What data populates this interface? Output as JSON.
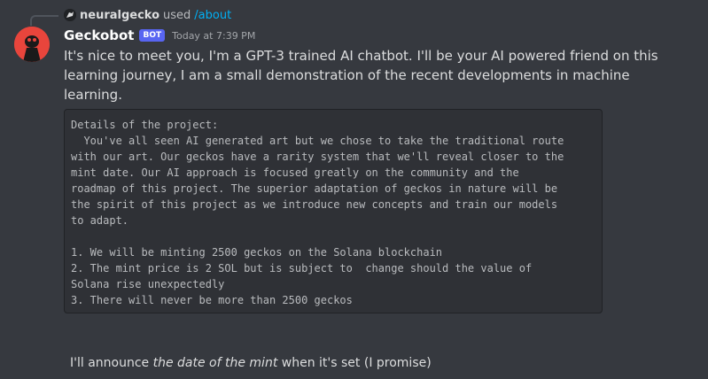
{
  "reply": {
    "username": "neuralgecko",
    "used_text": "used",
    "command": "/about"
  },
  "message": {
    "author": "Geckobot",
    "bot_tag": "BOT",
    "timestamp": "Today at 7:39 PM",
    "intro": "It's nice to meet you, I'm a GPT-3 trained AI chatbot. I'll be your AI powered friend on this learning journey, I am a small demonstration of the recent developments in machine learning.",
    "code": "Details of the project:\n  You've all seen AI generated art but we chose to take the traditional route\nwith our art. Our geckos have a rarity system that we'll reveal closer to the\nmint date. Our AI approach is focused greatly on the community and the\nroadmap of this project. The superior adaptation of geckos in nature will be\nthe spirit of this project as we introduce new concepts and train our models\nto adapt.\n\n1. We will be minting 2500 geckos on the Solana blockchain\n2. The mint price is 2 SOL but is subject to  change should the value of\nSolana rise unexpectedly\n3. There will never be more than 2500 geckos",
    "footer_before": "I'll announce ",
    "footer_emphasis": "the date of the mint",
    "footer_after": " when it's set (I promise)"
  },
  "colors": {
    "background": "#36393f",
    "code_background": "#2f3136",
    "bot_tag": "#5865f2",
    "command_link": "#00aff4",
    "avatar": "#e8453c"
  },
  "icons": {
    "reply_avatar": "gecko-avatar-icon",
    "bot_avatar": "gecko-avatar-icon"
  }
}
